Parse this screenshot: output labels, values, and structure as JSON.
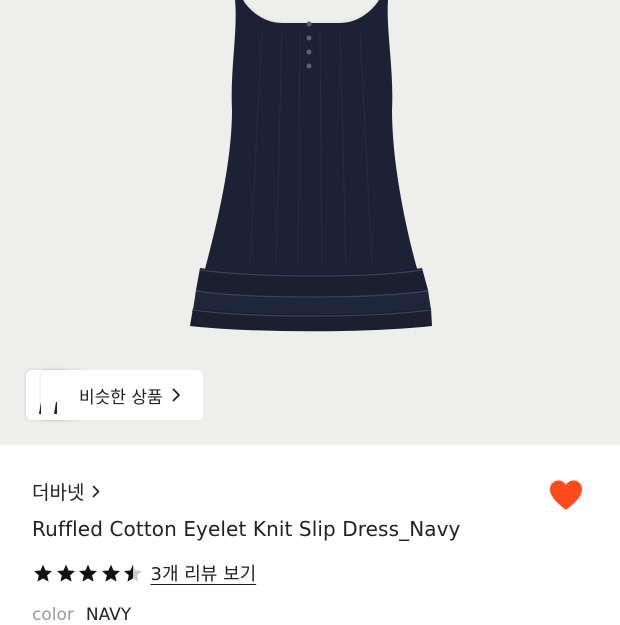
{
  "product": {
    "image_alt_icon": "dress-photo",
    "similar_button_label": "비슷한 상품",
    "brand": "더바넷",
    "title": "Ruffled Cotton Eyelet Knit Slip Dress_Navy",
    "rating": 4.5,
    "reviews_link": "3개 리뷰 보기",
    "color_label": "color",
    "color_value": "NAVY",
    "wishlisted": true
  },
  "colors": {
    "hero_bg": "#eeeeec",
    "dress": "#1c2233",
    "heart": "#ff4a1c",
    "star": "#111111",
    "star_empty": "#cccccc"
  }
}
